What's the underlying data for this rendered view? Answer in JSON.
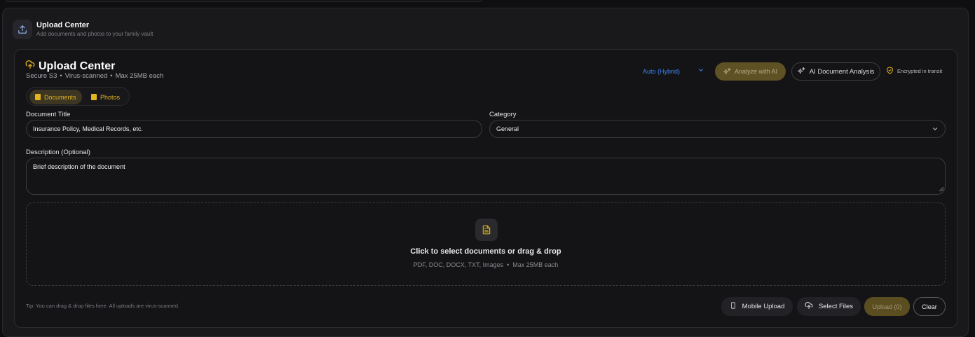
{
  "header": {
    "title": "Upload Center",
    "subtitle": "Add documents and photos to your family vault",
    "icon": "upload-icon"
  },
  "card": {
    "title": "Upload Center",
    "meta": [
      "Secure S3",
      "Virus-scanned",
      "Max 25MB each"
    ],
    "separator": "•"
  },
  "toolbar": {
    "mode_value": "Auto (Hybrid)",
    "analyze_label": "Analyze with AI",
    "doc_analysis_label": "AI Document Analysis",
    "encrypted_label": "Encrypted in transit"
  },
  "tabs": [
    {
      "label": "Documents",
      "active": true
    },
    {
      "label": "Photos",
      "active": false
    }
  ],
  "form": {
    "title_label": "Document Title",
    "title_placeholder": "Insurance Policy, Medical Records, etc.",
    "category_label": "Category",
    "category_value": "General",
    "description_label": "Description (Optional)",
    "description_placeholder": "Brief description of the document"
  },
  "dropzone": {
    "main": "Click to select documents or drag & drop",
    "formats": "PDF, DOC, DOCX, TXT, Images",
    "max": "Max 25MB each"
  },
  "footer": {
    "tip": "Tip: You can drag & drop files here. All uploads are virus-scanned.",
    "mobile_label": "Mobile Upload",
    "select_label": "Select Files",
    "upload_label": "Upload (0)",
    "clear_label": "Clear"
  },
  "colors": {
    "accent": "#e0b21e",
    "link_blue": "#3b82f6",
    "background": "#141416"
  }
}
